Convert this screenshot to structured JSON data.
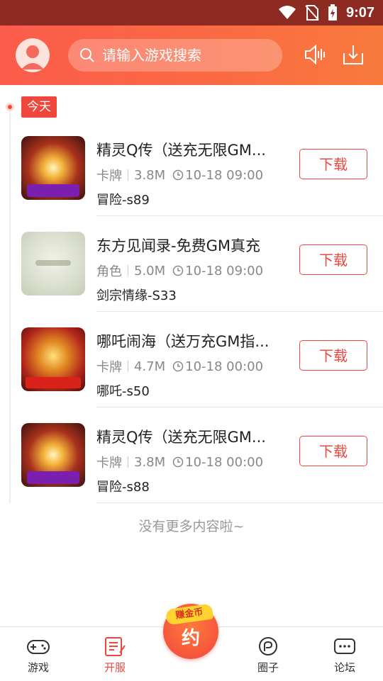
{
  "status_bar": {
    "time": "9:07"
  },
  "header": {
    "search_placeholder": "请输入游戏搜索",
    "avatar": "avatar-icon",
    "notice_icon": "speaker-icon",
    "download_icon": "download-tray-icon"
  },
  "timeline": {
    "day_label": "今天"
  },
  "games": [
    {
      "name": "精灵Q传（送充无限GM...",
      "category": "卡牌",
      "size": "3.8M",
      "time": "10-18 09:00",
      "server": "冒险-s89",
      "button": "下载",
      "icon_style": "art-1"
    },
    {
      "name": "东方见闻录-免费GM真充",
      "category": "角色",
      "size": "5.0M",
      "time": "10-18 09:00",
      "server": "剑宗情缘-S33",
      "button": "下载",
      "icon_style": "art-2"
    },
    {
      "name": "哪吒闹海（送万充GM指...",
      "category": "卡牌",
      "size": "4.7M",
      "time": "10-18 00:00",
      "server": "哪吒-s50",
      "button": "下载",
      "icon_style": "art-3"
    },
    {
      "name": "精灵Q传（送充无限GM...",
      "category": "卡牌",
      "size": "3.8M",
      "time": "10-18 00:00",
      "server": "冒险-s88",
      "button": "下载",
      "icon_style": "art-1"
    }
  ],
  "footer_text": "没有更多内容啦~",
  "tabbar": {
    "tabs": [
      {
        "label": "游戏",
        "icon": "gamepad-icon"
      },
      {
        "label": "开服",
        "icon": "open-server-icon"
      },
      {
        "label": "圈子",
        "icon": "circle-icon"
      },
      {
        "label": "论坛",
        "icon": "forum-icon"
      }
    ],
    "fab_badge": "赚金币",
    "fab_label": "约"
  },
  "colors": {
    "accent": "#f0473d",
    "header_start": "#fb5c4b",
    "header_end": "#f97a3d",
    "status_bar": "#8d2a22"
  }
}
